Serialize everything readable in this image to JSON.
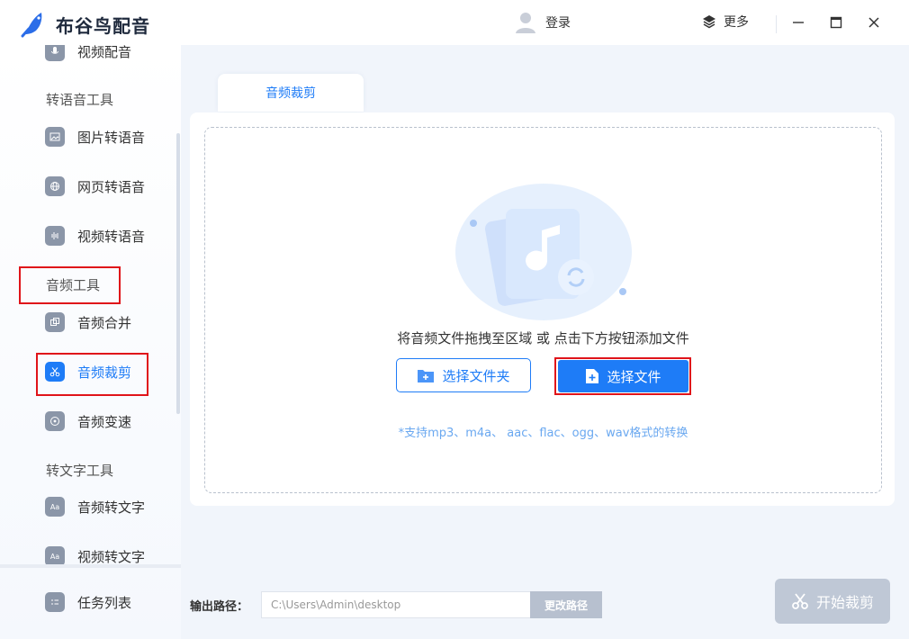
{
  "app": {
    "title": "布谷鸟配音"
  },
  "titlebar": {
    "login_label": "登录",
    "more_label": "更多"
  },
  "sidebar": {
    "top_partial_item": {
      "label": "视频配音",
      "icon": "mic-icon"
    },
    "sections": [
      {
        "label": "转语音工具"
      },
      {
        "label": "音频工具"
      },
      {
        "label": "转文字工具"
      }
    ],
    "items": [
      {
        "label": "图片转语音",
        "icon": "image-icon"
      },
      {
        "label": "网页转语音",
        "icon": "globe-icon"
      },
      {
        "label": "视频转语音",
        "icon": "video-icon"
      },
      {
        "label": "音频合并",
        "icon": "merge-icon"
      },
      {
        "label": "音频裁剪",
        "icon": "scissors-icon",
        "active": true
      },
      {
        "label": "音频变速",
        "icon": "speed-icon"
      },
      {
        "label": "音频转文字",
        "icon": "aa-chat-icon"
      },
      {
        "label": "视频转文字",
        "icon": "aa-video-icon"
      }
    ],
    "task_list_label": "任务列表"
  },
  "main": {
    "tab_label": "音频裁剪",
    "hint": "将音频文件拖拽至区域 或 点击下方按钮添加文件",
    "select_folder_label": "选择文件夹",
    "select_file_label": "选择文件",
    "formats_note": "*支持mp3、m4a、 aac、flac、ogg、wav格式的转换"
  },
  "bottom": {
    "output_label": "输出路径：",
    "output_path": "C:\\Users\\Admin\\desktop",
    "change_path_label": "更改路径",
    "start_label": "开始裁剪"
  },
  "colors": {
    "accent": "#1e7cf7",
    "highlight_box": "#e0141a",
    "disabled_button": "#bfc8d6"
  }
}
